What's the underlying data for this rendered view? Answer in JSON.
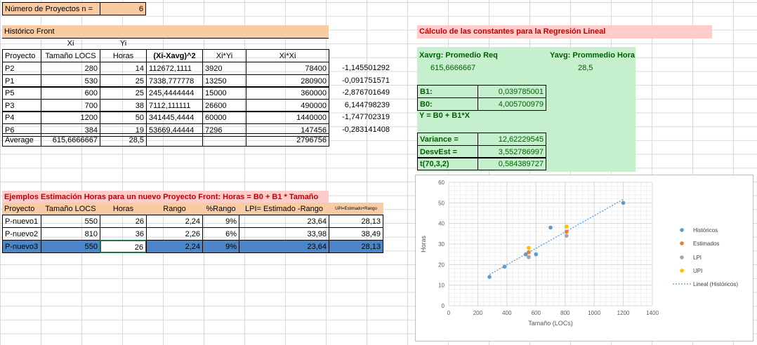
{
  "header": {
    "label": "Número de Proyectos n =",
    "value": "6"
  },
  "historico": {
    "title": "Histórico Front",
    "top_headers": [
      "Xi",
      "Yi"
    ],
    "headers": [
      "Proyecto",
      "Tamaño LOCS",
      "Horas",
      "(Xi-Xavg)^2",
      "Xi*Yi",
      "Xi*Xi"
    ],
    "rows": [
      [
        "P2",
        "280",
        "14",
        "112672,1111",
        "3920",
        "78400",
        "-1,145501292"
      ],
      [
        "P1",
        "530",
        "25",
        "7338,777778",
        "13250",
        "280900",
        "-0,091751571"
      ],
      [
        "P5",
        "600",
        "25",
        "245,4444444",
        "15000",
        "360000",
        "-2,876701649"
      ],
      [
        "P3",
        "700",
        "38",
        "7112,111111",
        "26600",
        "490000",
        "6,144798239"
      ],
      [
        "P4",
        "1200",
        "50",
        "341445,4444",
        "60000",
        "1440000",
        "-1,747702319"
      ],
      [
        "P6",
        "384",
        "19",
        "53669,44444",
        "7296",
        "147456",
        "-0,283141408"
      ]
    ],
    "average": [
      "Average",
      "615,6666667",
      "28,5",
      "",
      "",
      "2796756"
    ]
  },
  "calculo": {
    "title": "Cálculo de las constantes para la Regresión Lineal",
    "xavg_label": "Xavrg: Promedio Req",
    "xavg_value": "615,6666667",
    "yavg_label": "Yavg: Prommedio Horas",
    "yavg_value": "28,5",
    "b1_label": "B1:",
    "b1_value": "0,039785001",
    "b0_label": "B0:",
    "b0_value": "4,005700979",
    "formula": "Y = B0 + B1*X",
    "variance_label": "Variance =",
    "variance_value": "12,62229545",
    "desv_label": "DesvEst =",
    "desv_value": "3,552786997",
    "t_label": "t(70,3,2)",
    "t_value": "0,584389727"
  },
  "ejemplos": {
    "title": "Ejemplos Estimación Horas para un nuevo Proyecto Front:   Horas  = B0 + B1 * Tamaño",
    "headers": [
      "Proyecto",
      "Tamaño  LOCS",
      "Horas",
      "Rango",
      "%Rango",
      "LPI= Estimado -Rango",
      "UPI=Estimado+Rango"
    ],
    "rows": [
      [
        "P-nuevo1",
        "550",
        "26",
        "2,24",
        "9%",
        "23,64",
        "28,13"
      ],
      [
        "P-nuevo2",
        "810",
        "36",
        "2,26",
        "6%",
        "33,98",
        "38,49"
      ],
      [
        "P-nuevo3",
        "550",
        "26",
        "2,24",
        "9%",
        "23,64",
        "28,13"
      ]
    ]
  },
  "chart_data": {
    "type": "scatter",
    "xlabel": "Tamaño (LOCs)",
    "ylabel": "Horas",
    "xlim": [
      0,
      1400
    ],
    "ylim": [
      0,
      60
    ],
    "xticks": [
      0,
      200,
      400,
      600,
      800,
      1000,
      1200,
      1400
    ],
    "yticks": [
      0,
      10,
      20,
      30,
      40,
      50,
      60
    ],
    "grid": true,
    "legend_position": "right",
    "series": [
      {
        "name": "Históricos",
        "color": "#5b9bd5",
        "x": [
          280,
          530,
          600,
          700,
          1200,
          384
        ],
        "y": [
          14,
          25,
          25,
          38,
          50,
          19
        ]
      },
      {
        "name": "Estimados",
        "color": "#ed7d31",
        "x": [
          550,
          810,
          550
        ],
        "y": [
          26,
          36,
          26
        ]
      },
      {
        "name": "LPI",
        "color": "#a5a5a5",
        "x": [
          550,
          810,
          550
        ],
        "y": [
          23.64,
          33.98,
          23.64
        ]
      },
      {
        "name": "UPI",
        "color": "#ffc000",
        "x": [
          550,
          810,
          550
        ],
        "y": [
          28.13,
          38.49,
          28.13
        ]
      }
    ],
    "trendline": {
      "name": "Lineal (Históricos)",
      "color": "#5b9bd5",
      "intercept": 4.0057,
      "slope": 0.039785,
      "x_range": [
        280,
        1200
      ]
    }
  }
}
